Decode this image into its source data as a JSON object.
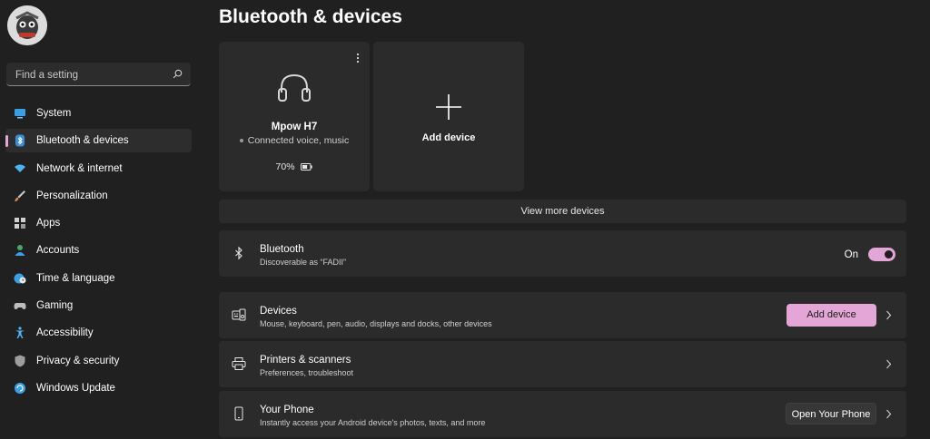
{
  "sidebar": {
    "search_placeholder": "Find a setting",
    "items": [
      {
        "label": "System",
        "icon": "system-icon",
        "active": false
      },
      {
        "label": "Bluetooth & devices",
        "icon": "bluetooth-icon",
        "active": true
      },
      {
        "label": "Network & internet",
        "icon": "wifi-icon",
        "active": false
      },
      {
        "label": "Personalization",
        "icon": "brush-icon",
        "active": false
      },
      {
        "label": "Apps",
        "icon": "apps-icon",
        "active": false
      },
      {
        "label": "Accounts",
        "icon": "person-icon",
        "active": false
      },
      {
        "label": "Time & language",
        "icon": "globe-clock-icon",
        "active": false
      },
      {
        "label": "Gaming",
        "icon": "gamepad-icon",
        "active": false
      },
      {
        "label": "Accessibility",
        "icon": "accessibility-icon",
        "active": false
      },
      {
        "label": "Privacy & security",
        "icon": "shield-icon",
        "active": false
      },
      {
        "label": "Windows Update",
        "icon": "update-icon",
        "active": false
      }
    ]
  },
  "page": {
    "title": "Bluetooth & devices"
  },
  "device_card": {
    "name": "Mpow H7",
    "status": "Connected voice, music",
    "battery": "70%",
    "battery_level": 0.7
  },
  "add_card": {
    "label": "Add device"
  },
  "view_more": "View more devices",
  "bluetooth_row": {
    "title": "Bluetooth",
    "subtitle": "Discoverable as “FADII”",
    "state": "On"
  },
  "devices_row": {
    "title": "Devices",
    "subtitle": "Mouse, keyboard, pen, audio, displays and docks, other devices",
    "button": "Add device"
  },
  "printers_row": {
    "title": "Printers & scanners",
    "subtitle": "Preferences, troubleshoot"
  },
  "phone_row": {
    "title": "Your Phone",
    "subtitle": "Instantly access your Android device's photos, texts, and more",
    "button": "Open Your Phone"
  },
  "colors": {
    "accent": "#e3a6d6",
    "background": "#202020",
    "card": "#2b2b2b"
  }
}
